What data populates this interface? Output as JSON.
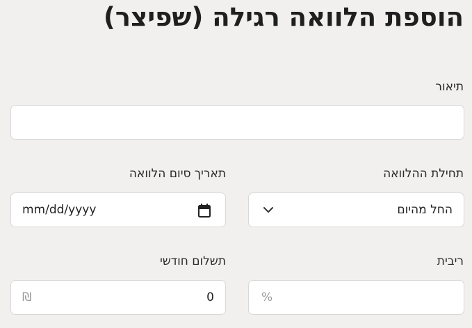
{
  "page": {
    "title": "הוספת הלוואה רגילה (שפיצר)"
  },
  "form": {
    "description": {
      "label": "תיאור",
      "value": ""
    },
    "loan_start": {
      "label": "תחילת ההלוואה",
      "selected": "החל מהיום"
    },
    "loan_end_date": {
      "label": "תאריך סיום הלוואה",
      "placeholder": "mm/dd/yyyy"
    },
    "interest": {
      "label": "ריבית",
      "suffix": "%",
      "value": ""
    },
    "monthly_payment": {
      "label": "תשלום חודשי",
      "value": "0",
      "suffix": "₪"
    }
  },
  "icons": {
    "dropdown": "chevron-down-icon",
    "date": "calendar-icon"
  }
}
